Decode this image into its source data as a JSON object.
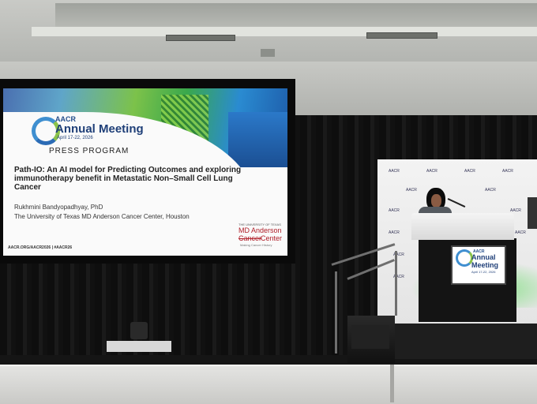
{
  "slide": {
    "brand": "AACR",
    "event": "Annual Meeting",
    "dates": "April 17-22, 2026",
    "program": "PRESS PROGRAM",
    "title": "Path-IO: An AI model for Predicting Outcomes and exploring immunotherapy benefit in Metastatic Non–Small Cell Lung Cancer",
    "speaker": "Rukhmini Bandyopadhyay, PhD",
    "affiliation": "The University of Texas MD Anderson Cancer Center, Houston",
    "footer": "AACR.ORG/AACR2026  |  #AACR26",
    "logo_small": "THE UNIVERSITY OF TEXAS",
    "logo_main": "MD Anderson",
    "logo_cancer": "Cancer",
    "logo_center": "Center",
    "logo_tag": "Making Cancer History"
  },
  "backdrop": {
    "repeat_label": "AACR"
  },
  "podium_sign": {
    "brand": "AACR",
    "line1": "Annual",
    "line2": "Meeting",
    "dates": "April 17-22, 2026"
  },
  "colors": {
    "aacr_blue": "#1f3f78",
    "aacr_green": "#8bc34a",
    "mda_red": "#b0202a"
  }
}
